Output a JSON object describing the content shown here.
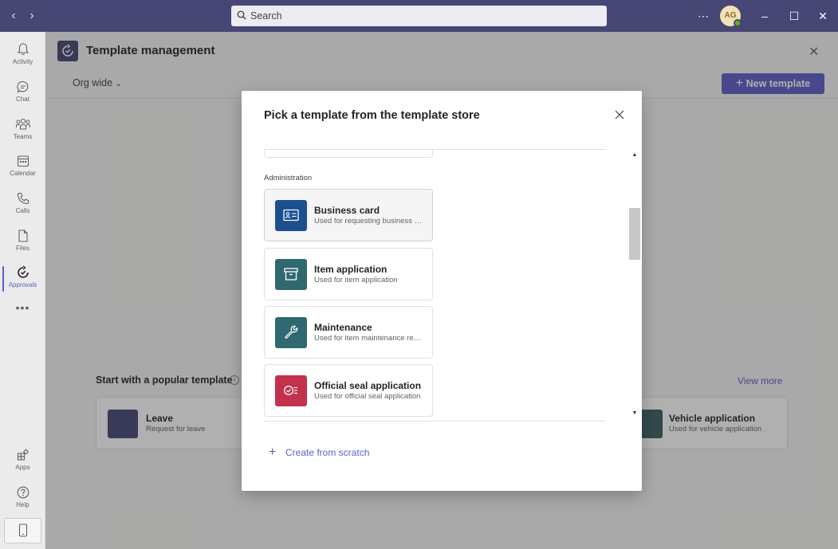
{
  "titlebar": {
    "search_placeholder": "Search",
    "avatar_initials": "AG"
  },
  "rail": {
    "items": [
      {
        "label": "Activity",
        "icon": "bell-icon"
      },
      {
        "label": "Chat",
        "icon": "chat-icon"
      },
      {
        "label": "Teams",
        "icon": "teams-icon"
      },
      {
        "label": "Calendar",
        "icon": "calendar-icon"
      },
      {
        "label": "Calls",
        "icon": "phone-icon"
      },
      {
        "label": "Files",
        "icon": "file-icon"
      },
      {
        "label": "Approvals",
        "icon": "approvals-icon"
      }
    ],
    "bottom": [
      {
        "label": "Apps",
        "icon": "apps-icon"
      },
      {
        "label": "Help",
        "icon": "help-icon"
      }
    ]
  },
  "page": {
    "title": "Template management",
    "filter": "Org wide",
    "new_template_label": "New template",
    "popular_title": "Start with a popular template",
    "view_more": "View more",
    "popular": [
      {
        "title": "Leave",
        "subtitle": "Request for leave",
        "color": "#464775"
      },
      {
        "title": "Vehicle application",
        "subtitle": "Used for vehicle application",
        "color": "#3b5f66"
      }
    ]
  },
  "dialog": {
    "title": "Pick a template from the template store",
    "section": "Administration",
    "templates": [
      {
        "title": "Business card",
        "subtitle": "Used for requesting business cards",
        "color": "#1c4f8e",
        "icon": "contact-card-icon"
      },
      {
        "title": "Item application",
        "subtitle": "Used for item application",
        "color": "#2f6870",
        "icon": "archive-box-icon"
      },
      {
        "title": "Maintenance",
        "subtitle": "Used for item maintenance requests",
        "color": "#2f6870",
        "icon": "wrench-icon"
      },
      {
        "title": "Official seal application",
        "subtitle": "Used for official seal application",
        "color": "#c4314b",
        "icon": "seal-icon"
      }
    ],
    "create_from_scratch": "Create from scratch"
  },
  "colors": {
    "titlebar": "#464775",
    "accent": "#5b5fc7"
  }
}
